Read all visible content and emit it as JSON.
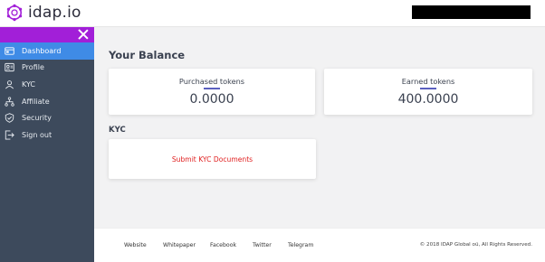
{
  "header": {
    "brand": "idap.io",
    "accent": "#a21fd8"
  },
  "sidebar": {
    "items": [
      {
        "label": "Dashboard",
        "icon": "dashboard-icon",
        "active": true
      },
      {
        "label": "Profile",
        "icon": "profile-icon"
      },
      {
        "label": "KYC",
        "icon": "kyc-icon"
      },
      {
        "label": "Affiliate",
        "icon": "affiliate-icon"
      },
      {
        "label": "Security",
        "icon": "shield-icon"
      },
      {
        "label": "Sign out",
        "icon": "sign-out-icon"
      }
    ],
    "active_color": "#3f8be6",
    "background": "#3d4a5c"
  },
  "main": {
    "balance_title": "Your Balance",
    "cards": [
      {
        "label": "Purchased tokens",
        "value": "0.0000"
      },
      {
        "label": "Earned tokens",
        "value": "400.0000"
      }
    ],
    "kyc_title": "KYC",
    "kyc_link": "Submit KYC Documents"
  },
  "footer": {
    "links": [
      "Website",
      "Whitepaper",
      "Facebook",
      "Twitter",
      "Telegram"
    ],
    "copyright": "© 2018 IDAP Global oü, All Rights Reserved."
  }
}
